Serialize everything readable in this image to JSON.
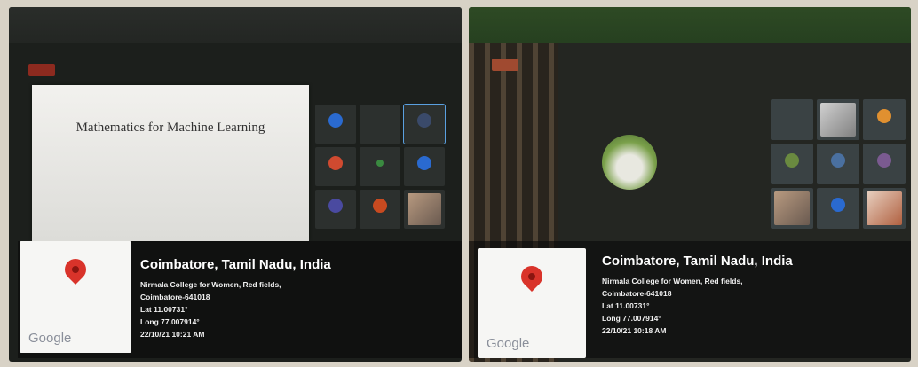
{
  "photos": [
    {
      "slide_title": "Mathematics for Machine Learning",
      "location": {
        "city": "Coimbatore, Tamil Nadu, India",
        "address": "Nirmala College for Women, Red fields,",
        "postcode": "Coimbatore-641018",
        "lat": "Lat 11.00731°",
        "long": "Long 77.007914°",
        "datetime": "22/10/21 10:21 AM"
      },
      "brand": "Google"
    },
    {
      "location": {
        "city": "Coimbatore, Tamil Nadu, India",
        "address": "Nirmala College for Women, Red fields,",
        "postcode": "Coimbatore-641018",
        "lat": "Lat 11.00731°",
        "long": "Long 77.007914°",
        "datetime": "22/10/21 10:18 AM"
      },
      "brand": "Google"
    }
  ],
  "colors": {
    "pin": "#d9332a",
    "overlay": "#0a0a0a",
    "card": "#f6f6f4"
  }
}
